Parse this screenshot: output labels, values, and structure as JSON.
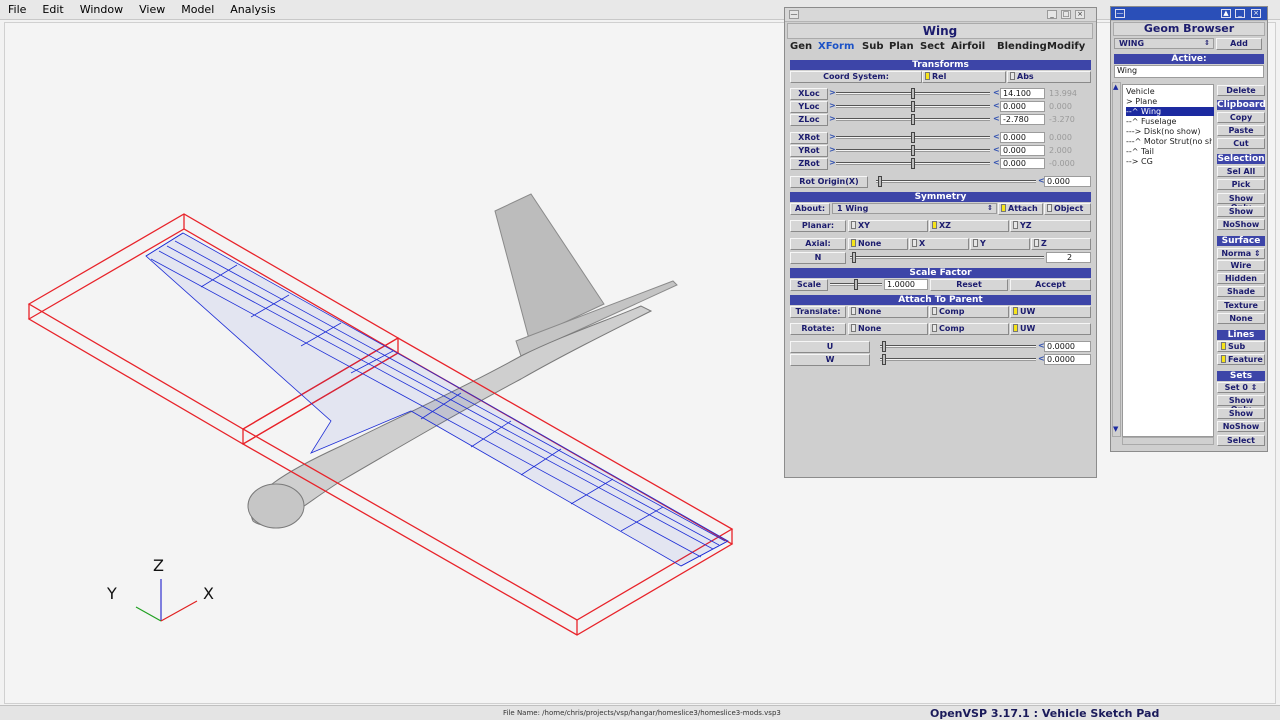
{
  "menu": [
    "File",
    "Edit",
    "Window",
    "View",
    "Model",
    "Analysis"
  ],
  "status": {
    "file_name": "File Name: /home/chris/projects/vsp/hangar/homeslice3/homeslice3-mods.vsp3",
    "app_title": "OpenVSP 3.17.1 : Vehicle Sketch Pad"
  },
  "axes": {
    "z": "Z",
    "y": "Y",
    "x": "X"
  },
  "colors": {
    "header": "#3d45a8",
    "accent_text": "#1c1c6e",
    "check_on": "#f6e419",
    "wire": "#1f2fd6",
    "bbox": "#e8232a"
  },
  "wing_window": {
    "title": "Wing",
    "tabs": [
      "Gen",
      "XForm",
      "Sub",
      "Plan",
      "Sect",
      "Airfoil",
      "Blending",
      "Modify"
    ],
    "active_tab": "XForm",
    "transforms": {
      "header": "Transforms",
      "coord_label": "Coord System:",
      "rel": "Rel",
      "abs": "Abs",
      "rows": [
        {
          "label": "XLoc",
          "value": "14.100",
          "ro": "13.994",
          "pos": 0.5
        },
        {
          "label": "YLoc",
          "value": "0.000",
          "ro": "0.000",
          "pos": 0.5
        },
        {
          "label": "ZLoc",
          "value": "-2.780",
          "ro": "-3.270",
          "pos": 0.5
        },
        {
          "label": "XRot",
          "value": "0.000",
          "ro": "0.000",
          "pos": 0.5
        },
        {
          "label": "YRot",
          "value": "0.000",
          "ro": "2.000",
          "pos": 0.5
        },
        {
          "label": "ZRot",
          "value": "0.000",
          "ro": "-0.000",
          "pos": 0.5
        }
      ],
      "rot_origin_label": "Rot Origin(X)",
      "rot_origin_value": "0.000"
    },
    "symmetry": {
      "header": "Symmetry",
      "about_label": "About:",
      "about_value": "1 Wing",
      "attach": "Attach",
      "object": "Object",
      "planar_label": "Planar:",
      "planar": [
        "XY",
        "XZ",
        "YZ"
      ],
      "axial_label": "Axial:",
      "axial": [
        "None",
        "X",
        "Y",
        "Z"
      ],
      "n_label": "N",
      "n_value": "2"
    },
    "scale": {
      "header": "Scale Factor",
      "label": "Scale",
      "value": "1.0000",
      "reset": "Reset",
      "accept": "Accept"
    },
    "attach": {
      "header": "Attach To Parent",
      "translate_label": "Translate:",
      "rotate_label": "Rotate:",
      "options": [
        "None",
        "Comp",
        "UW"
      ],
      "u_label": "U",
      "u_value": "0.0000",
      "w_label": "W",
      "w_value": "0.0000"
    }
  },
  "geom_browser": {
    "title": "Geom Browser",
    "type_select": "WING",
    "add": "Add",
    "active_header": "Active:",
    "active_value": "Wing",
    "tree": [
      "Vehicle",
      "> Plane",
      "--^ Wing",
      "--^ Fuselage",
      "---> Disk(no show)",
      "---^ Motor Strut(no sh",
      "--^ Tail",
      "--> CG"
    ],
    "tree_selected_index": 2,
    "buttons": {
      "delete": "Delete",
      "clipboard": "Clipboard",
      "copy": "Copy",
      "paste": "Paste",
      "cut": "Cut",
      "selection": "Selection",
      "sel_all": "Sel All",
      "pick": "Pick",
      "show_only": "Show Only",
      "show": "Show",
      "noshow": "NoShow",
      "surface": "Surface",
      "surface_select": "Norma",
      "wire": "Wire",
      "hidden": "Hidden",
      "shade": "Shade",
      "texture": "Texture",
      "none": "None",
      "lines": "Lines",
      "sub": "Sub",
      "feature": "Feature",
      "sets": "Sets",
      "set_select": "Set 0",
      "sets_show_only": "Show Only",
      "sets_show": "Show",
      "sets_noshow": "NoShow",
      "select": "Select"
    }
  }
}
